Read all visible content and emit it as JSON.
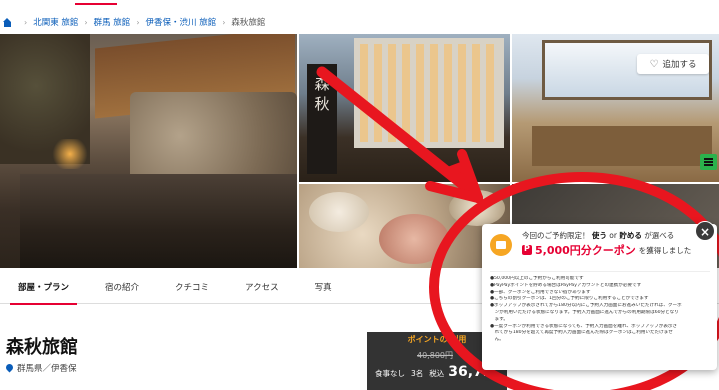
{
  "breadcrumb": {
    "items": [
      "北関東 旅館",
      "群馬 旅館",
      "伊香保・渋川 旅館"
    ],
    "current": "森秋旅館"
  },
  "gallery": {
    "sign_text": "森秋",
    "add_favorite_label": "追加する"
  },
  "tabs": [
    {
      "label": "部屋・プラン",
      "active": true
    },
    {
      "label": "宿の紹介",
      "active": false
    },
    {
      "label": "クチコミ",
      "active": false
    },
    {
      "label": "アクセス",
      "active": false
    },
    {
      "label": "写真",
      "active": false
    }
  ],
  "hotel": {
    "name": "森秋旅館",
    "location": "群馬県／伊香保"
  },
  "price": {
    "banner": "ポイントの 利用",
    "old_price": "40,800円",
    "meal": "食事なし",
    "guests": "3名",
    "tax_label": "税込",
    "value": "36,72"
  },
  "popup": {
    "line1_prefix": "今回のご予約限定！",
    "line1_use": "使う",
    "line1_or": "or",
    "line1_save": "貯める",
    "line1_suffix": "が選べる",
    "amount": "5,000円分クーポン",
    "amount_suffix": "を獲得しました",
    "close_label": "×",
    "notes": [
      "●50,000円以上のご予約からご利用可能です",
      "●PayPayポイントを貯める場合はPayPayアカウントとの連携が必要です",
      "●一部、クーポンをご利用できない宿があります",
      "●こちらの割引クーポンは、1回分のご予約に限りご利用することができます",
      "●ポップアップが表示されてから180分以内にご予約入力画面にお進みいただければ、クーポ",
      "　ンが利用いただける状態になります。予約入力画面に進んでからの利用期限は60分となり",
      "　ます。",
      "●一度クーポンが利用できる状態になっても、予約入力画面を離れ、ポップアップが表示さ",
      "　れてから180分を超えて再度予約入力画面に進んだ際はクーポンはご利用いただけませ",
      "　ん。"
    ]
  },
  "colors": {
    "accent_red": "#e60033",
    "link_blue": "#0a5db9",
    "coupon_orange": "#f6a623"
  }
}
